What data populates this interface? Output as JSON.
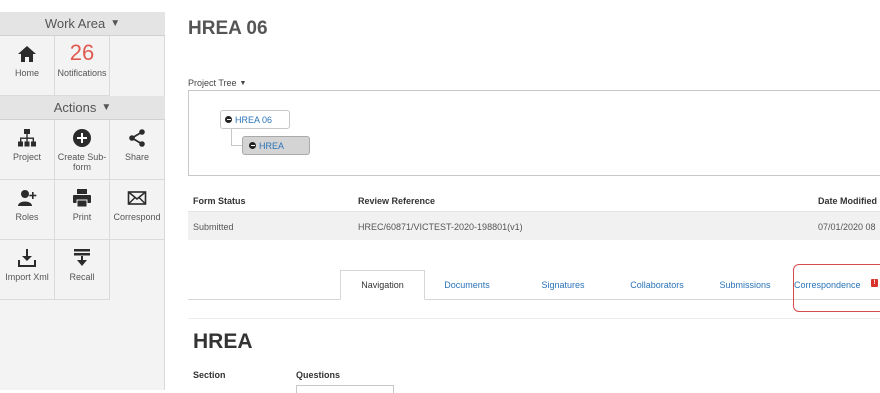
{
  "sidebar": {
    "work_area_label": "Work Area",
    "actions_label": "Actions",
    "home_label": "Home",
    "notifications_count": "26",
    "notifications_label": "Notifications",
    "tiles": {
      "project": "Project",
      "create_sub_form": "Create Sub-form",
      "share": "Share",
      "roles": "Roles",
      "print": "Print",
      "correspond": "Correspond",
      "import_xml": "Import Xml",
      "recall": "Recall"
    }
  },
  "main": {
    "title": "HREA 06",
    "project_tree_label": "Project Tree",
    "tree": {
      "root": "HREA 06",
      "child": "HREA"
    },
    "table": {
      "headers": [
        "Form Status",
        "Review Reference",
        "Date Modified"
      ],
      "row": [
        "Submitted",
        "HREC/60871/VICTEST-2020-198801(v1)",
        "07/01/2020 08"
      ]
    },
    "tabs": [
      "Navigation",
      "Documents",
      "Signatures",
      "Collaborators",
      "Submissions",
      "Correspondence"
    ],
    "active_tab": "Navigation",
    "correspondence_badge": "!",
    "section_title": "HREA",
    "columns": [
      "Section",
      "Questions"
    ]
  },
  "colors": {
    "accent": "#2a73b8",
    "notification": "#e05a4f",
    "highlight": "#d94a4a"
  }
}
